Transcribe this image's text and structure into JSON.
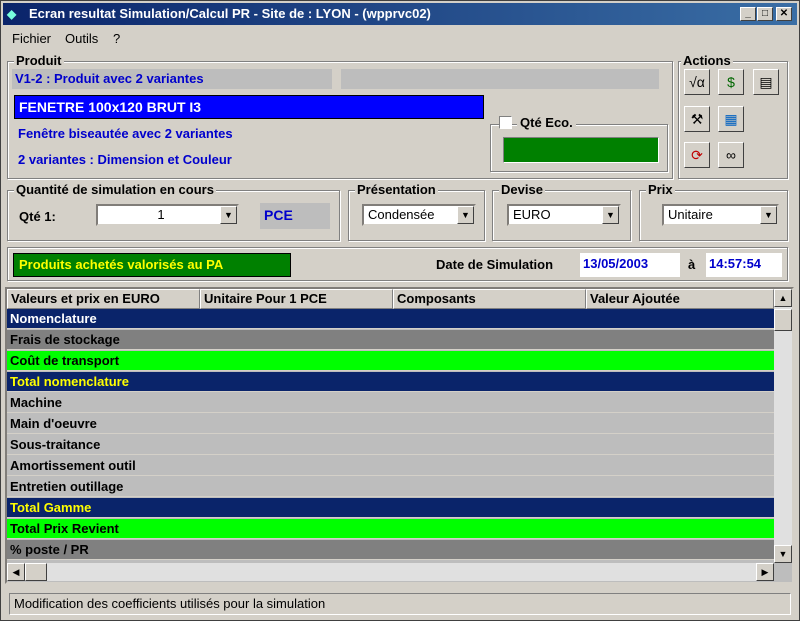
{
  "window": {
    "title": "Ecran resultat Simulation/Calcul PR - Site de : LYON - (wpprvc02)",
    "app_icon": "app-icon",
    "minimize": "_",
    "maximize": "□",
    "close": "✕"
  },
  "menu": [
    {
      "label": "Fichier"
    },
    {
      "label": "Outils"
    },
    {
      "label": "?"
    }
  ],
  "produit": {
    "group_label": "Produit",
    "variant_code": "V1-2 : Produit avec 2 variantes",
    "name": "FENETRE 100x120 BRUT I3",
    "description1": "Fenêtre biseautée avec 2 variantes",
    "description2": "2 variantes : Dimension et Couleur",
    "qte_eco_label": "Qté Eco.",
    "qte_eco_checked": false
  },
  "actions": {
    "group_label": "Actions",
    "buttons": [
      {
        "icon": "sqrt-calc-icon",
        "glyph": "√α"
      },
      {
        "icon": "money-icon",
        "glyph": "$"
      },
      {
        "icon": "calculator-icon",
        "glyph": "▤"
      },
      {
        "icon": "tools-icon",
        "glyph": "⚒"
      },
      {
        "icon": "chart-icon",
        "glyph": "▦"
      },
      {
        "icon": "refresh-icon",
        "glyph": "⟳"
      },
      {
        "icon": "glasses-icon",
        "glyph": "∞"
      }
    ]
  },
  "quantite": {
    "group_label": "Quantité de simulation en cours",
    "label": "Qté 1:",
    "value": "1",
    "unit": "PCE"
  },
  "presentation": {
    "group_label": "Présentation",
    "value": "Condensée"
  },
  "devise": {
    "group_label": "Devise",
    "value": "EURO"
  },
  "prix": {
    "group_label": "Prix",
    "value": "Unitaire"
  },
  "info": {
    "pa_label": "Produits achetés valorisés au PA",
    "date_label": "Date de Simulation",
    "date_value": "13/05/2003",
    "a_label": "à",
    "time_value": "14:57:54"
  },
  "grid": {
    "columns": [
      "Valeurs et prix en EURO",
      "Unitaire Pour 1 PCE",
      "Composants",
      "Valeur Ajoutée"
    ],
    "rows": [
      {
        "label": "Nomenclature",
        "style": "navy"
      },
      {
        "label": "Frais de stockage",
        "style": "dgray"
      },
      {
        "label": "Coût de transport",
        "style": "green"
      },
      {
        "label": "Total nomenclature",
        "style": "navy-yellow"
      },
      {
        "label": "Machine",
        "style": "lgray"
      },
      {
        "label": "Main d'oeuvre",
        "style": "lgray"
      },
      {
        "label": "Sous-traitance",
        "style": "lgray"
      },
      {
        "label": "Amortissement outil",
        "style": "lgray"
      },
      {
        "label": "Entretien outillage",
        "style": "lgray"
      },
      {
        "label": "Total Gamme",
        "style": "navy-yellow"
      },
      {
        "label": "Total Prix Revient",
        "style": "green"
      },
      {
        "label": "% poste / PR",
        "style": "dgray"
      }
    ]
  },
  "status": {
    "text": "Modification des coefficients utilisés pour la simulation"
  }
}
